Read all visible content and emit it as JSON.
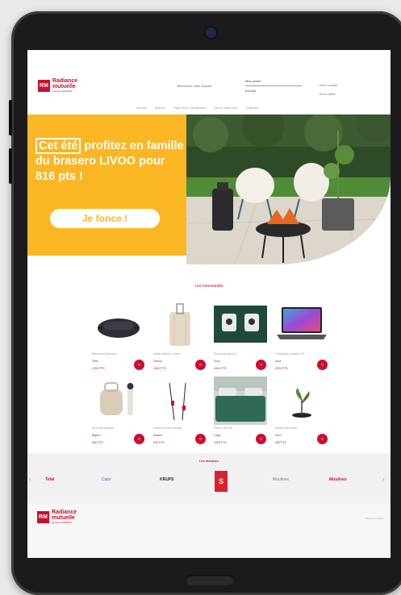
{
  "site": {
    "brand_name_line1": "Radiance",
    "brand_name_line2": "mutuelle",
    "tagline": "Groupe HUMANIS",
    "header_center": "Bienvenue Jean Dupont",
    "points_label": "Mes points",
    "points_sub": "816 pts",
    "account_link": "Mon compte",
    "help_link": "Nous aider"
  },
  "nav": [
    "Accueil",
    "Maison",
    "High-Tech / Multimédia",
    "Sport / Bien-être",
    "Cadeaux"
  ],
  "hero": {
    "title_boxed": "Cet été",
    "title_rest": " profitez en famille du brasero LIVOO pour 816 pts !",
    "button_label": "Je fonce !"
  },
  "products_section_title": "Les nouveautés",
  "products": [
    {
      "name": "Barbecue électrique",
      "brand": "Tefal",
      "price": "1200 PTS"
    },
    {
      "name": "Valise cabine 4 roues",
      "brand": "Delsey",
      "price": "3400 PTS"
    },
    {
      "name": "Écouteurs sans fil",
      "brand": "Sony",
      "price": "1600 PTS"
    },
    {
      "name": "Ordinateur portable 14\"",
      "brand": "Asus",
      "price": "9200 PTS"
    },
    {
      "name": "Enceinte karaoké",
      "brand": "Bigben",
      "price": "980 PTS"
    },
    {
      "name": "Lampe de table design",
      "brand": "Maison",
      "price": "820 PTS"
    },
    {
      "name": "Parure de lit lin",
      "brand": "Linge",
      "price": "1500 PTS"
    },
    {
      "name": "Plante décorative",
      "brand": "Déco",
      "price": "450 PTS"
    }
  ],
  "brands_section_title": "Les marques",
  "brands": [
    {
      "name": "Tefal",
      "color": "#c8102e"
    },
    {
      "name": "Calor",
      "color": "#4a6fb0"
    },
    {
      "name": "KRUPS",
      "color": "#222222"
    },
    {
      "name": "Moulinex",
      "color": "#777777"
    },
    {
      "name": "Moulinex",
      "color": "#c8102e"
    }
  ],
  "footer_legal": "Mentions légales",
  "colors": {
    "accent": "#c8102e",
    "hero_yellow": "#fbb624"
  }
}
